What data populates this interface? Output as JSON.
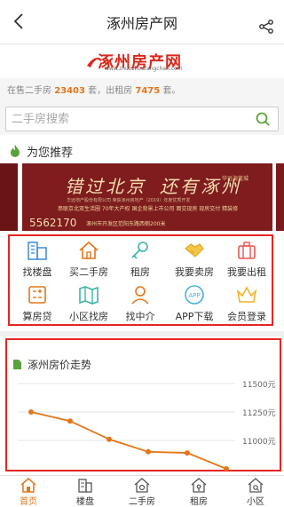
{
  "header": {
    "title": "涿州房产网"
  },
  "logo": {
    "text": "涿州房产网",
    "subtitle": "www.zhuozhoufangchan.com"
  },
  "stats": {
    "sale_prefix": "在售二手房",
    "sale_count": "23403",
    "sale_unit": "套，出租房",
    "rent_count": "7475",
    "rent_unit": "套。"
  },
  "search": {
    "placeholder": "二手房搜索"
  },
  "recommend": {
    "title": "为您推荐"
  },
  "banner": {
    "headline_1": "错过北京",
    "headline_2": "还有涿州",
    "brand": "华远海蓝城",
    "line_small": "华远地产股份有限公司 荣获涿州房地产（2019）年度优秀开发",
    "line_features": "串联京北双生活圈 70年大产权 国企背景上市公司 面交现房 现房交付 精装修",
    "phone": "5562170",
    "address": "涿州市开发区范阳东路西侧200米"
  },
  "grid": {
    "items": [
      {
        "label": "找楼盘",
        "icon": "building-icon"
      },
      {
        "label": "买二手房",
        "icon": "house-icon"
      },
      {
        "label": "租房",
        "icon": "key-icon"
      },
      {
        "label": "我要卖房",
        "icon": "handshake-icon"
      },
      {
        "label": "我要出租",
        "icon": "suitcase-icon"
      },
      {
        "label": "算房贷",
        "icon": "calculator-icon"
      },
      {
        "label": "小区找房",
        "icon": "map-icon"
      },
      {
        "label": "找中介",
        "icon": "person-icon"
      },
      {
        "label": "APP下载",
        "icon": "app-icon"
      },
      {
        "label": "会员登录",
        "icon": "crown-icon"
      }
    ]
  },
  "trend": {
    "title": "涿州房价走势"
  },
  "chart_data": {
    "type": "line",
    "title": "涿州房价走势",
    "x": [
      1,
      2,
      3,
      4,
      5,
      6
    ],
    "values": [
      11250,
      11170,
      11010,
      10900,
      10890,
      10750
    ],
    "ylim": [
      10750,
      11500
    ],
    "yticks": [
      "11500元",
      "11250元",
      "11000元"
    ],
    "ytick_values": [
      11500,
      11250,
      11000
    ],
    "color": "#e2761a",
    "grid": true
  },
  "tabbar": {
    "tabs": [
      {
        "label": "首页",
        "active": true
      },
      {
        "label": "楼盘",
        "active": false
      },
      {
        "label": "二手房",
        "active": false
      },
      {
        "label": "租房",
        "active": false
      },
      {
        "label": "小区",
        "active": false
      }
    ]
  },
  "colors": {
    "accent": "#e2761a",
    "highlight": "#e52521",
    "banner": "#7e1c1e"
  }
}
